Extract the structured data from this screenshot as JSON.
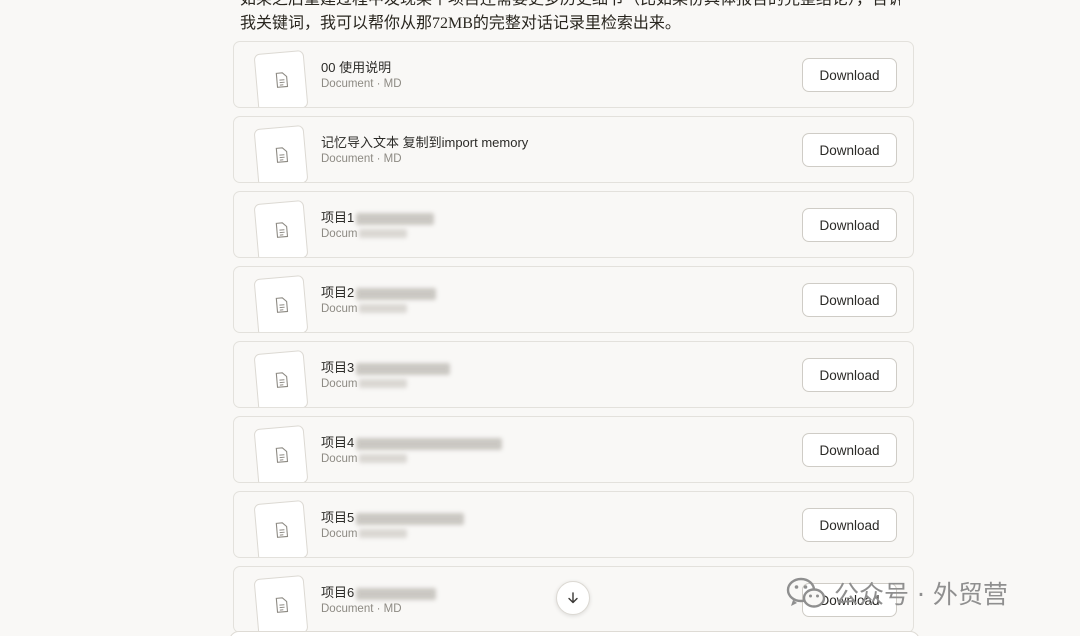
{
  "message": {
    "line1": "如果之后重建过程中发现某个项目还需要更多历史细节（比如某份具体报告的完整结论），告诉",
    "line2": "我关键词，我可以帮你从那72MB的完整对话记录里检索出来。"
  },
  "files": [
    {
      "title": "00 使用说明",
      "meta": "Document · MD",
      "download_label": "Download"
    },
    {
      "title": "记忆导入文本 复制到import memory",
      "meta": "Document · MD",
      "download_label": "Download"
    },
    {
      "title": "项目1",
      "meta": "Docum",
      "download_label": "Download"
    },
    {
      "title": "项目2",
      "meta": "Docum",
      "download_label": "Download"
    },
    {
      "title": "项目3",
      "meta": "Docum",
      "download_label": "Download"
    },
    {
      "title": "项目4",
      "meta": "Docum",
      "download_label": "Download"
    },
    {
      "title": "项目5",
      "meta": "Docum",
      "download_label": "Download"
    },
    {
      "title": "项目6",
      "meta": "Document · MD",
      "download_label": "Download"
    }
  ],
  "icons": {
    "file": "document-file-icon",
    "scroll": "arrow-down-icon",
    "watermark": "wechat-icon"
  },
  "watermark": {
    "text": "公众号 · 外贸营"
  }
}
